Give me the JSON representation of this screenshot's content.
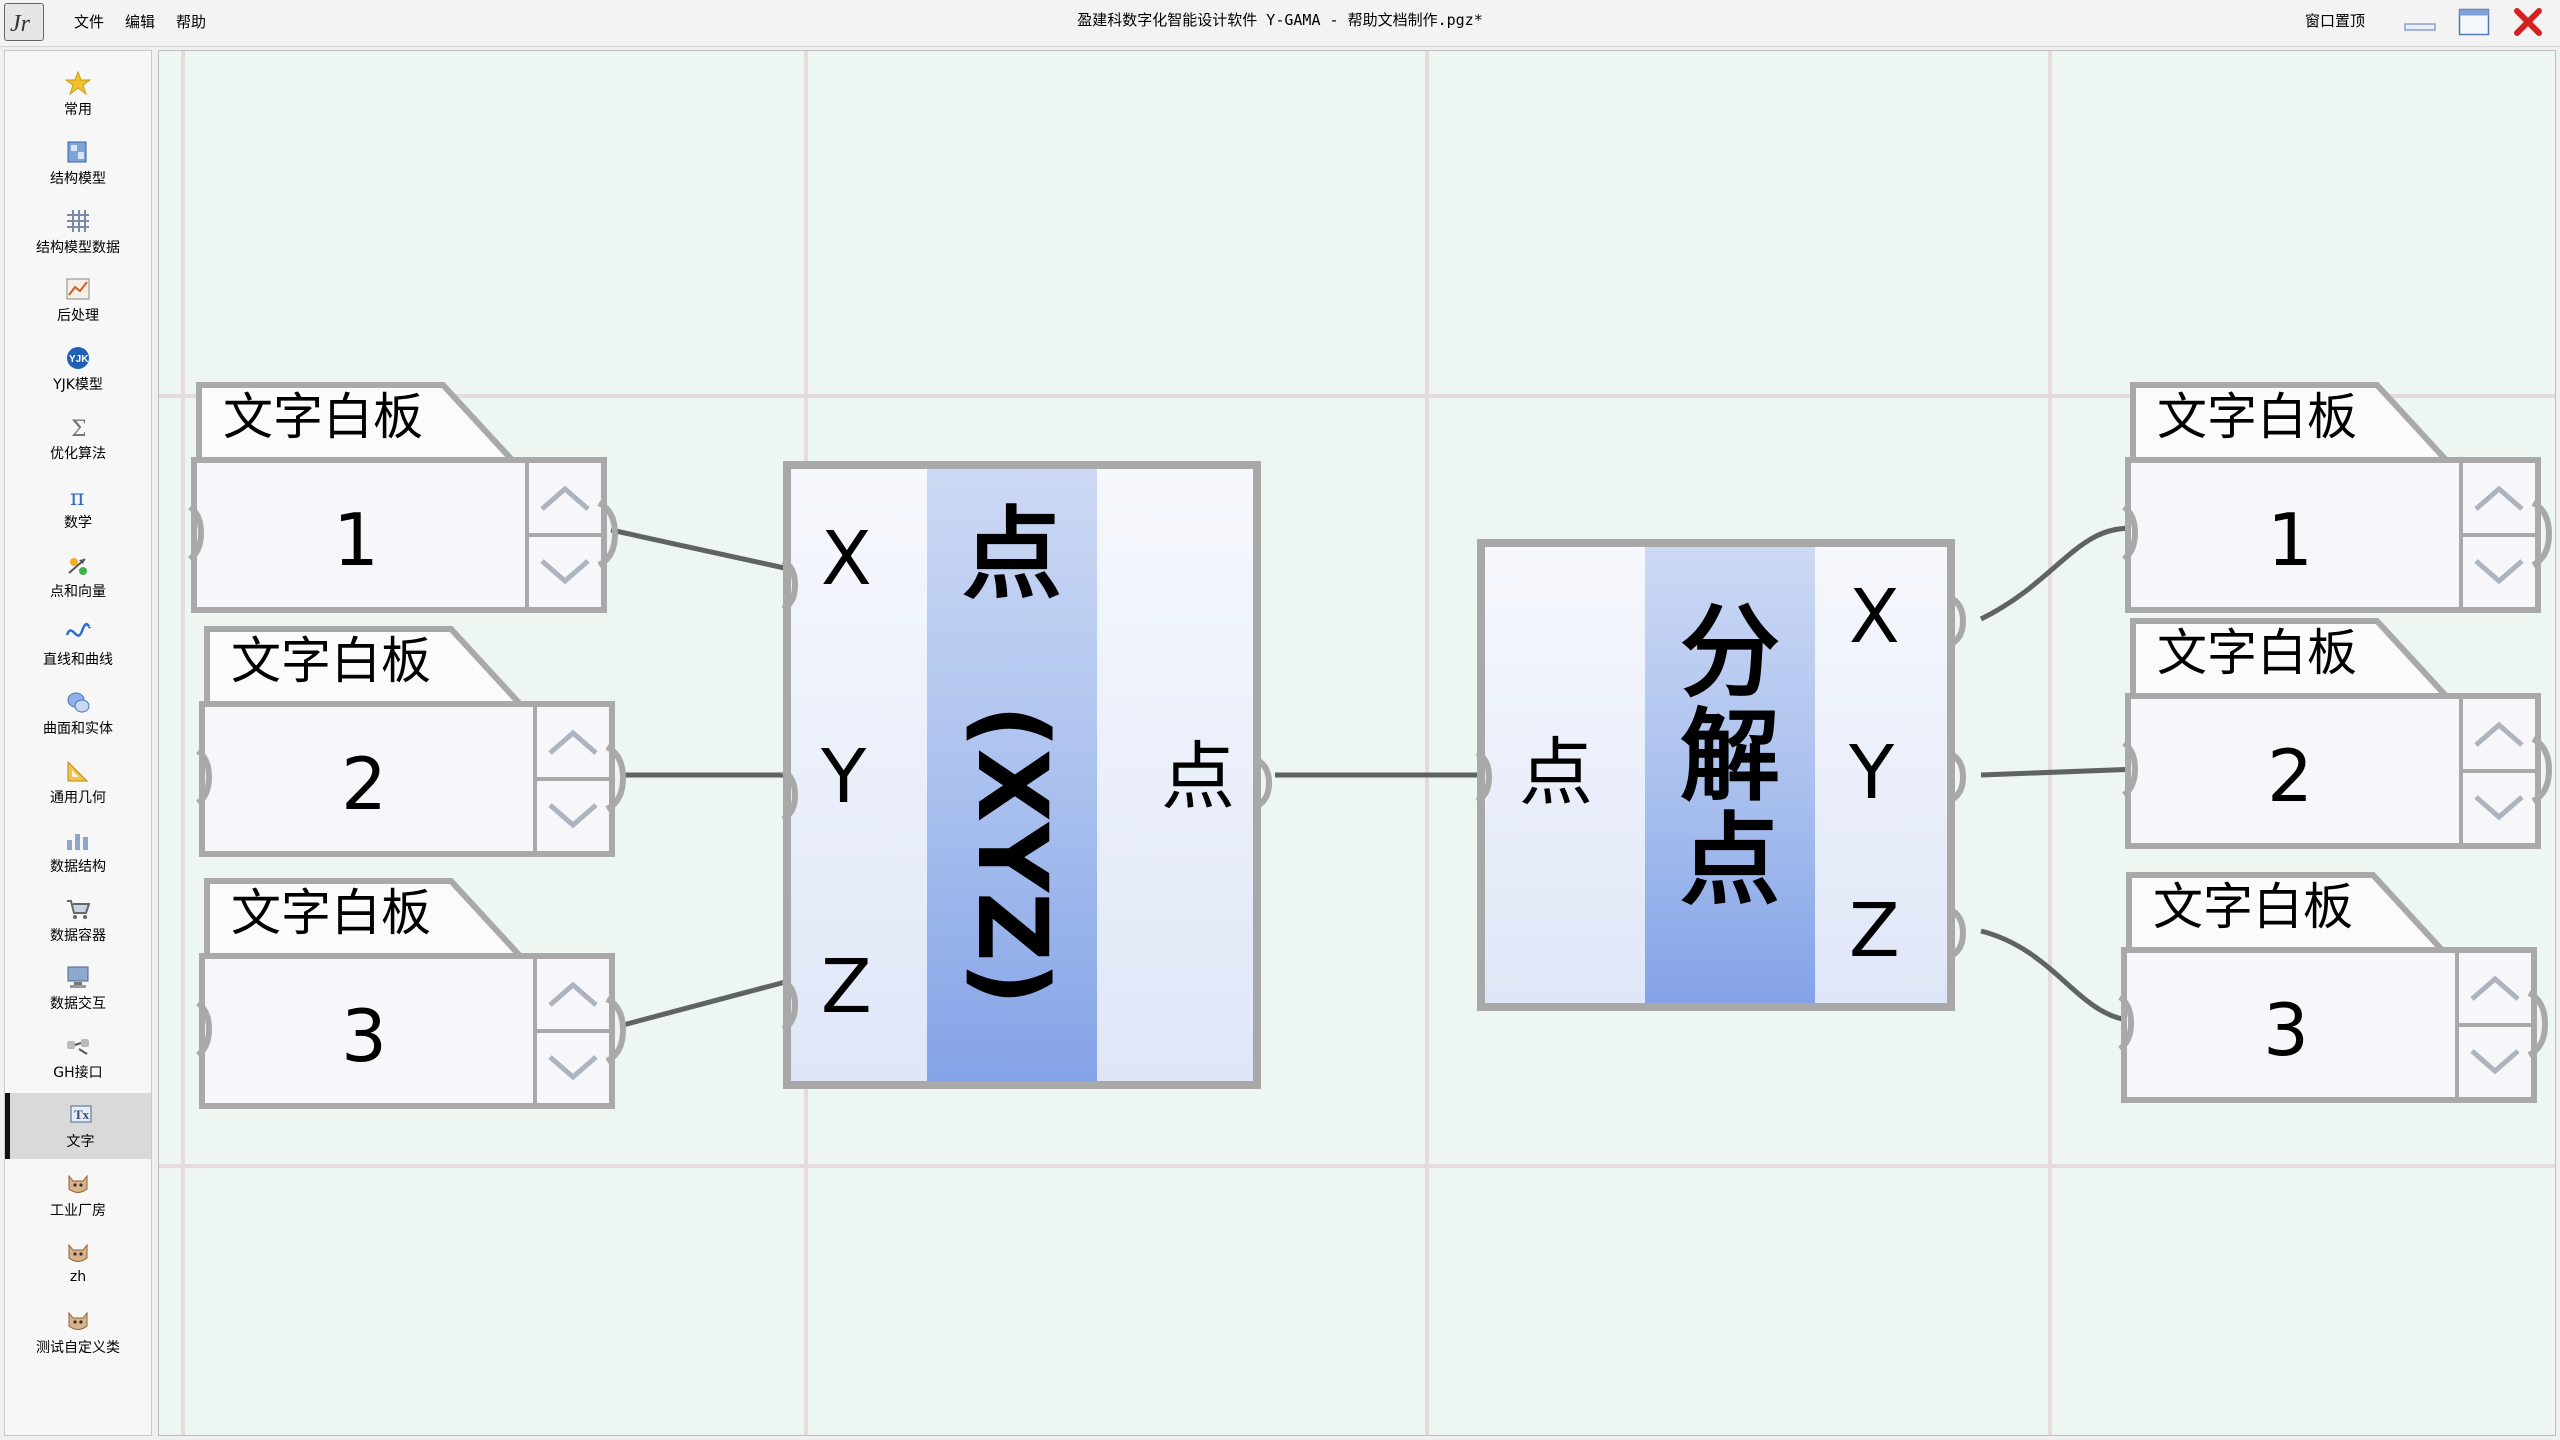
{
  "app": {
    "window_title": "盈建科数字化智能设计软件 Y-GAMA - 帮助文档制作.pgz*",
    "menu": [
      "文件",
      "编辑",
      "帮助"
    ],
    "topmost_label": "窗口置顶",
    "logo_text": "Jr"
  },
  "sidebar": {
    "items": [
      {
        "label": "常用",
        "icon": "star-icon"
      },
      {
        "label": "结构模型",
        "icon": "structure-model-icon"
      },
      {
        "label": "结构模型数据",
        "icon": "grid-data-icon"
      },
      {
        "label": "后处理",
        "icon": "postprocess-icon"
      },
      {
        "label": "YJK模型",
        "icon": "yjk-globe-icon"
      },
      {
        "label": "优化算法",
        "icon": "sigma-icon"
      },
      {
        "label": "数学",
        "icon": "pi-icon"
      },
      {
        "label": "点和向量",
        "icon": "point-vector-icon"
      },
      {
        "label": "直线和曲线",
        "icon": "curve-icon"
      },
      {
        "label": "曲面和实体",
        "icon": "surface-icon"
      },
      {
        "label": "通用几何",
        "icon": "triangle-ruler-icon"
      },
      {
        "label": "数据结构",
        "icon": "bar-data-icon"
      },
      {
        "label": "数据容器",
        "icon": "cart-icon"
      },
      {
        "label": "数据交互",
        "icon": "computer-icon"
      },
      {
        "label": "GH接口",
        "icon": "gh-interface-icon"
      },
      {
        "label": "文字",
        "icon": "text-icon"
      },
      {
        "label": "工业厂房",
        "icon": "cat-icon"
      },
      {
        "label": "zh",
        "icon": "cat-icon"
      },
      {
        "label": "测试自定义类",
        "icon": "cat-icon"
      }
    ],
    "active_label": "文字"
  },
  "canvas": {
    "left_panels": [
      {
        "title": "文字白板",
        "value": "1"
      },
      {
        "title": "文字白板",
        "value": "2"
      },
      {
        "title": "文字白板",
        "value": "3"
      }
    ],
    "right_panels": [
      {
        "title": "文字白板",
        "value": "1"
      },
      {
        "title": "文字白板",
        "value": "2"
      },
      {
        "title": "文字白板",
        "value": "3"
      }
    ],
    "construct_point": {
      "title": "点",
      "subtitle": "(XYZ)",
      "inputs": [
        "X",
        "Y",
        "Z"
      ],
      "output": "点"
    },
    "deconstruct_point": {
      "title_chars": [
        "分",
        "解",
        "点"
      ],
      "input": "点",
      "outputs": [
        "X",
        "Y",
        "Z"
      ]
    }
  },
  "colors": {
    "canvas_bg": "#edf6f1",
    "grid_line": "#e7dada",
    "node_border": "#a8a8a8",
    "node_center_bottom": "#84a3e7",
    "wire": "#5f6461",
    "close_red": "#d42020"
  }
}
